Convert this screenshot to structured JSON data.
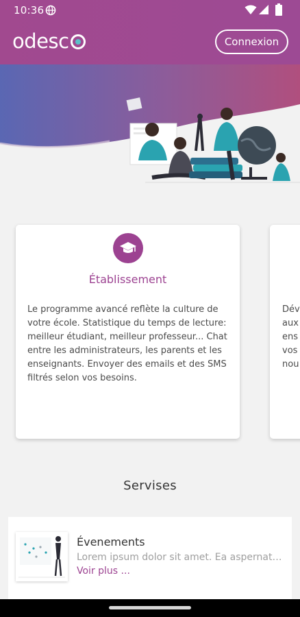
{
  "status_bar": {
    "time": "10:36",
    "icons": [
      "globe-icon",
      "wifi-icon",
      "signal-icon",
      "battery-icon"
    ]
  },
  "header": {
    "logo_text": "odesc",
    "login_label": "Connexion"
  },
  "colors": {
    "brand_purple": "#9c4291",
    "header_gradient_start": "#a1498f",
    "hero_gradient_start": "#5a67b3",
    "hero_gradient_end": "#b04f7e",
    "background": "#f2f2f2"
  },
  "features": {
    "cards": [
      {
        "icon": "graduation-cap-icon",
        "title": "Établissement",
        "description": "Le programme avancé reflète la culture de votre école. Statistique du temps de lecture: meilleur étudiant, meilleur professeur... Chat entre les administrateurs, les parents et les enseignants. Envoyer des emails et des SMS filtrés selon vos besoins."
      }
    ],
    "next_card_peek": [
      "Dév",
      "aux",
      "ens",
      "vos",
      "nou"
    ]
  },
  "services": {
    "title": "Servises",
    "items": [
      {
        "title": "Évenements",
        "description": "Lorem ipsum dolor sit amet. Ea aspernatur m...",
        "link": "Voir plus ..."
      }
    ]
  }
}
